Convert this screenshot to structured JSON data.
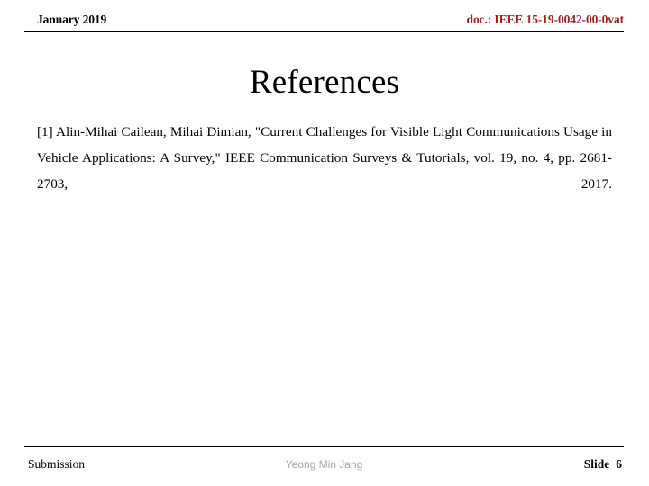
{
  "slide": {
    "header": {
      "date": "January 2019",
      "doc_id": "doc.: IEEE 15-19-0042-00-0vat",
      "doc_color": "#a02020"
    },
    "title": "References",
    "body": {
      "references": [
        "[1]  Alin-Mihai Cailean, Mihai Dimian, \"Current Challenges for Visible Light Communications Usage in Vehicle Applications: A Survey,\" IEEE Communication Surveys & Tutorials, vol. 19, no. 4, pp. 2681-2703, 2017."
      ]
    },
    "footer": {
      "left": "Submission",
      "center": "Yeong Min Jang",
      "slide_label": "Slide",
      "slide_number": "6"
    }
  }
}
